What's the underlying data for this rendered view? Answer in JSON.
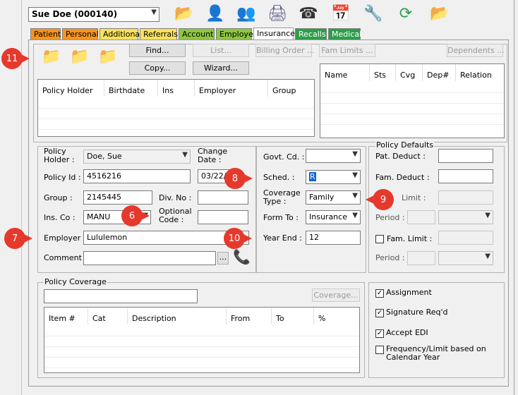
{
  "patient_selector": {
    "value": "Sue Doe (000140)"
  },
  "toolbar": {
    "icons": [
      "folder-open-icon",
      "person-icon",
      "people-icon",
      "printer-icon",
      "fax-icon",
      "calendar-icon",
      "wrench-icon",
      "refresh-icon",
      "folder-swap-icon"
    ]
  },
  "tabs": [
    {
      "label": "Patient",
      "color": "#f7941d"
    },
    {
      "label": "Personal",
      "color": "#f7941d"
    },
    {
      "label": "Additional",
      "color": "#fbe15b"
    },
    {
      "label": "Referrals",
      "color": "#fbe15b"
    },
    {
      "label": "Account",
      "color": "#8dc63f"
    },
    {
      "label": "Employer",
      "color": "#8dc63f"
    },
    {
      "label": "Insurance",
      "color": "#ffffff"
    },
    {
      "label": "Recalls",
      "color": "#2e9e4a"
    },
    {
      "label": "Medical",
      "color": "#2e9e4a"
    }
  ],
  "buttons": {
    "find": "Find...",
    "list": "List...",
    "billing_order": "Billing Order ...",
    "fam_limits": "Fam Limits ...",
    "dependents": "Dependents ...",
    "copy": "Copy...",
    "wizard": "Wizard...",
    "coverage": "Coverage...",
    "ellipsis": "..."
  },
  "policy_table": {
    "columns": [
      "Policy Holder",
      "Birthdate",
      "Ins",
      "Employer",
      "Group"
    ]
  },
  "dependents_table": {
    "columns": [
      "Name",
      "Sts",
      "Cvg",
      "Dep#",
      "Relation"
    ]
  },
  "form": {
    "policy_holder_label": "Policy\nHolder :",
    "policy_holder_value": "Doe, Sue",
    "change_date_label": "Change\nDate :",
    "change_date_value": "03/22/",
    "policy_id_label": "Policy Id :",
    "policy_id_value": "4516216",
    "group_label": "Group :",
    "group_value": "2145445",
    "div_no_label": "Div. No :",
    "ins_co_label": "Ins. Co :",
    "ins_co_value": "MANU",
    "optional_code_label": "Optional\nCode :",
    "employer_label": "Employer :",
    "employer_value": "Lululemon",
    "comment_label": "Comment :",
    "govt_cd_label": "Govt. Cd. :",
    "sched_label": "Sched. :",
    "sched_value": "R",
    "coverage_type_label": "Coverage\nType :",
    "coverage_type_value": "Family",
    "form_to_label": "Form To :",
    "form_to_value": "Insurance",
    "year_end_label": "Year End :",
    "year_end_value": "12"
  },
  "policy_defaults": {
    "title": "Policy Defaults",
    "pat_deduct_label": "Pat. Deduct :",
    "fam_deduct_label": "Fam. Deduct :",
    "limit_label": "Limit :",
    "period_label": "Period :",
    "fam_limit_label": "Fam. Limit :",
    "period2_label": "Period :"
  },
  "policy_coverage": {
    "title": "Policy Coverage",
    "columns": [
      "Item #",
      "Cat",
      "Description",
      "From",
      "To",
      "%"
    ]
  },
  "checkboxes": [
    {
      "label": "Assignment",
      "checked": true
    },
    {
      "label": "Signature Req'd",
      "checked": true
    },
    {
      "label": "Accept EDI",
      "checked": true
    },
    {
      "label": "Frequency/Limit based on\nCalendar Year",
      "checked": false
    }
  ],
  "callouts": {
    "c11": "11",
    "c8": "8",
    "c9": "9",
    "c6": "6",
    "c7": "7",
    "c10": "10"
  }
}
